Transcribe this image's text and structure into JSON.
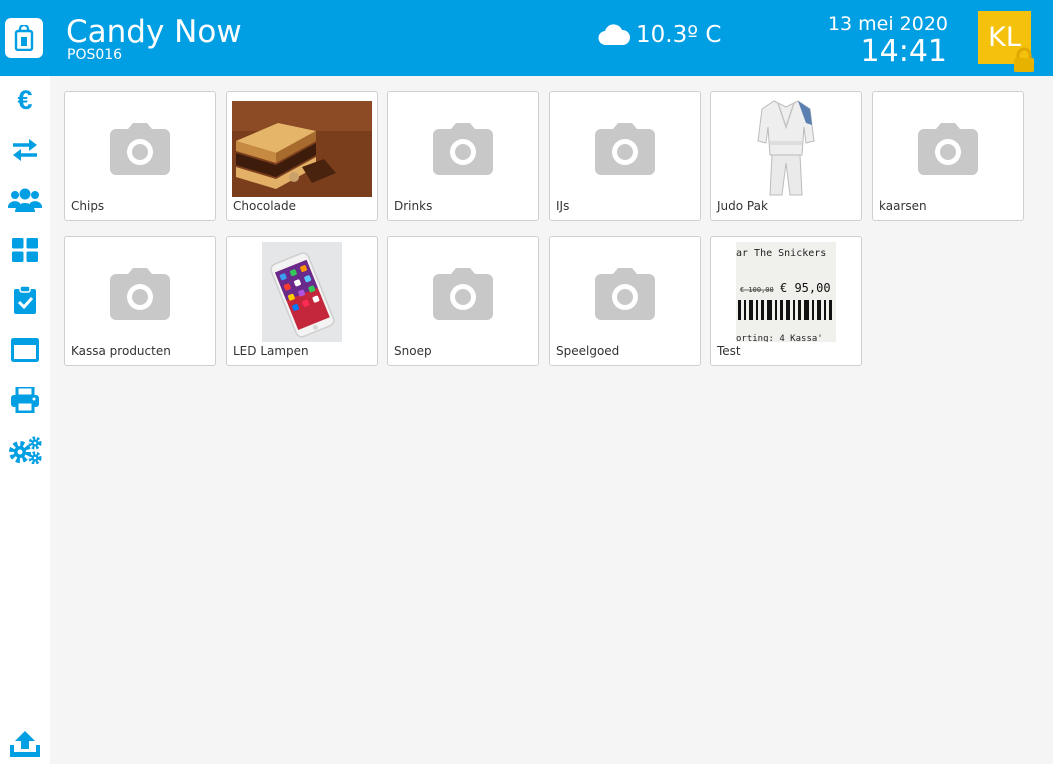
{
  "header": {
    "app_name": "Candy Now",
    "terminal": "POS016",
    "weather": "10.3º C",
    "date": "13 mei 2020",
    "time": "14:41",
    "user_initials": "KL"
  },
  "sidebar": {
    "items": [
      {
        "name": "euro-icon",
        "label": "€"
      },
      {
        "name": "transfer-icon"
      },
      {
        "name": "users-icon"
      },
      {
        "name": "grid-icon"
      },
      {
        "name": "clipboard-check-icon"
      },
      {
        "name": "window-icon"
      },
      {
        "name": "printer-icon"
      },
      {
        "name": "settings-icon"
      },
      {
        "name": "upload-icon"
      }
    ]
  },
  "categories": [
    {
      "label": "Chips",
      "image": "camera-placeholder-icon"
    },
    {
      "label": "Chocolade",
      "image": "chocolate-photo"
    },
    {
      "label": "Drinks",
      "image": "camera-placeholder-icon"
    },
    {
      "label": "IJs",
      "image": "camera-placeholder-icon"
    },
    {
      "label": "Judo Pak",
      "image": "judo-suit-photo"
    },
    {
      "label": "kaarsen",
      "image": "camera-placeholder-icon"
    },
    {
      "label": "Kassa producten",
      "image": "camera-placeholder-icon"
    },
    {
      "label": "LED Lampen",
      "image": "phone-photo"
    },
    {
      "label": "Snoep",
      "image": "camera-placeholder-icon"
    },
    {
      "label": "Speelgoed",
      "image": "camera-placeholder-icon"
    },
    {
      "label": "Test",
      "image": "price-label-photo"
    }
  ],
  "price_label_photo": {
    "line1": "ar The Snickers",
    "old_price": "€ 100,00",
    "new_price": "€ 95,00",
    "footer": "orting: 4 Kassa'"
  },
  "colors": {
    "brand": "#009ee3",
    "avatar": "#f4c20d",
    "placeholder": "#c8c8c8"
  }
}
